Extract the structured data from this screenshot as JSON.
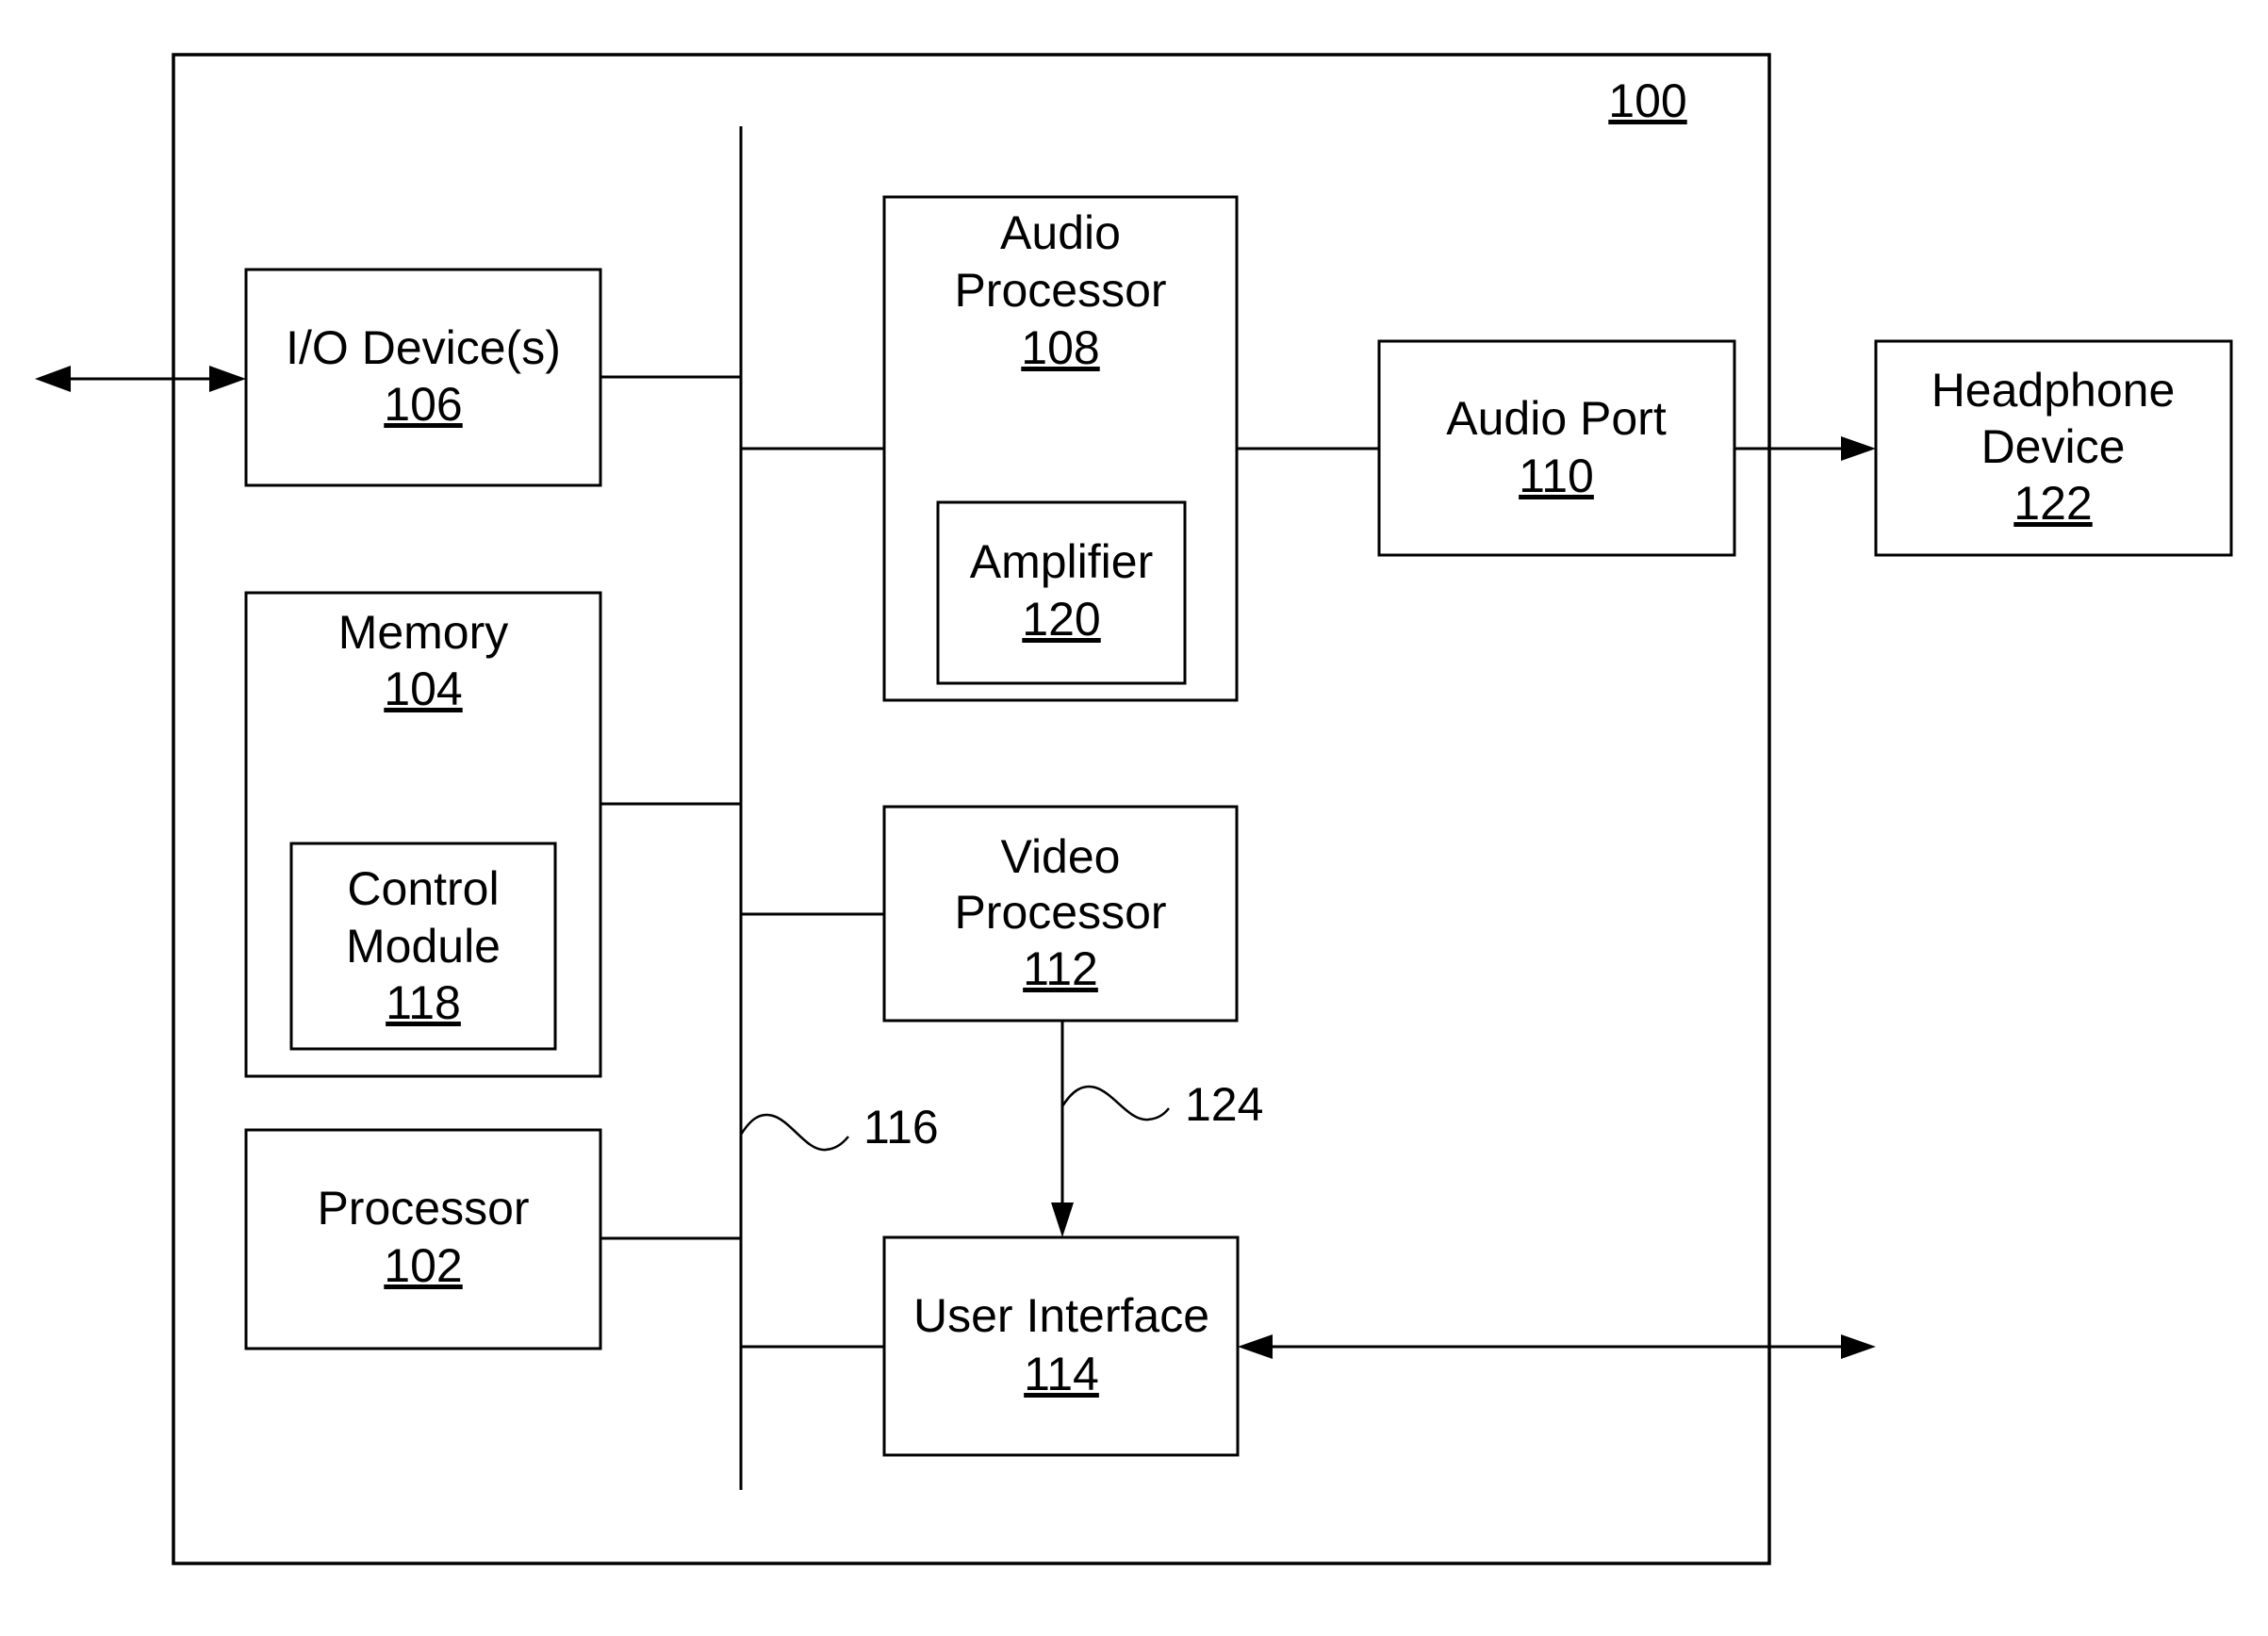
{
  "figure": {
    "system_ref": "100",
    "bus_ref": "116",
    "video_link_ref": "124"
  },
  "blocks": {
    "io": {
      "label": "I/O Device(s)",
      "ref": "106"
    },
    "memory": {
      "label": "Memory",
      "ref": "104"
    },
    "control": {
      "label_lines": [
        "Control",
        "Module"
      ],
      "ref": "118"
    },
    "processor": {
      "label": "Processor",
      "ref": "102"
    },
    "audio_processor": {
      "label_lines": [
        "Audio",
        "Processor"
      ],
      "ref": "108"
    },
    "amplifier": {
      "label": "Amplifier",
      "ref": "120"
    },
    "audio_port": {
      "label": "Audio Port",
      "ref": "110"
    },
    "headphone": {
      "label_lines": [
        "Headphone",
        "Device"
      ],
      "ref": "122"
    },
    "video_processor": {
      "label_lines": [
        "Video",
        "Processor"
      ],
      "ref": "112"
    },
    "user_interface": {
      "label": "User Interface",
      "ref": "114"
    }
  },
  "connections": [
    {
      "from": "external",
      "to": "io",
      "type": "bidirectional"
    },
    {
      "from": "io",
      "to": "bus",
      "type": "line"
    },
    {
      "from": "memory",
      "to": "bus",
      "type": "line"
    },
    {
      "from": "processor",
      "to": "bus",
      "type": "line"
    },
    {
      "from": "bus",
      "to": "audio_processor",
      "type": "line"
    },
    {
      "from": "bus",
      "to": "video_processor",
      "type": "line"
    },
    {
      "from": "bus",
      "to": "user_interface",
      "type": "line"
    },
    {
      "from": "audio_processor",
      "to": "audio_port",
      "type": "line"
    },
    {
      "from": "audio_port",
      "to": "headphone",
      "type": "arrow"
    },
    {
      "from": "video_processor",
      "to": "user_interface",
      "type": "arrow",
      "ref": "124"
    },
    {
      "from": "user_interface",
      "to": "external",
      "type": "bidirectional"
    }
  ],
  "colors": {
    "stroke": "#000000",
    "background": "#ffffff"
  }
}
